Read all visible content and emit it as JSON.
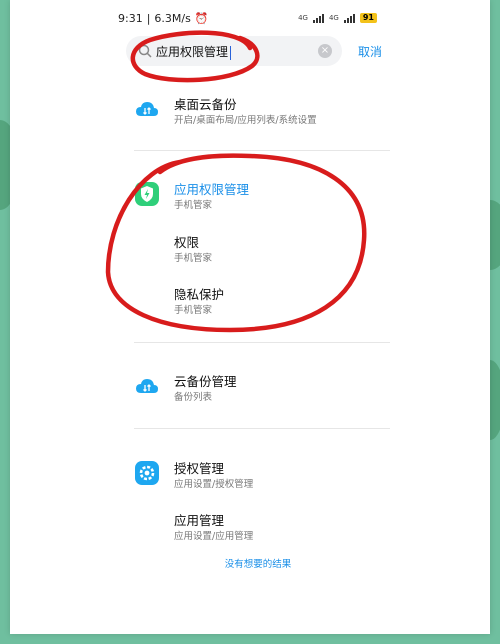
{
  "status_bar": {
    "time": "9:31",
    "speed": "6.3M/s",
    "net1": "4G",
    "net2": "4G",
    "battery": "91"
  },
  "search": {
    "value": "应用权限管理",
    "cancel_label": "取消"
  },
  "results": [
    {
      "title": "桌面云备份",
      "subtitle": "开启/桌面布局/应用列表/系统设置",
      "icon": "cloud-icon"
    },
    {
      "title": "应用权限管理",
      "subtitle": "手机管家",
      "icon": "security-icon",
      "highlight": true
    },
    {
      "title": "权限",
      "subtitle": "手机管家"
    },
    {
      "title": "隐私保护",
      "subtitle": "手机管家"
    },
    {
      "title": "云备份管理",
      "subtitle": "备份列表",
      "icon": "cloud-icon"
    },
    {
      "title": "授权管理",
      "subtitle": "应用设置/授权管理",
      "icon": "settings-icon"
    },
    {
      "title": "应用管理",
      "subtitle": "应用设置/应用管理"
    }
  ],
  "footer": {
    "no_result_link": "没有想要的结果"
  },
  "colors": {
    "accent": "#1a8fe8",
    "annotation": "#d81c1c",
    "background": "#6fbf9f"
  }
}
